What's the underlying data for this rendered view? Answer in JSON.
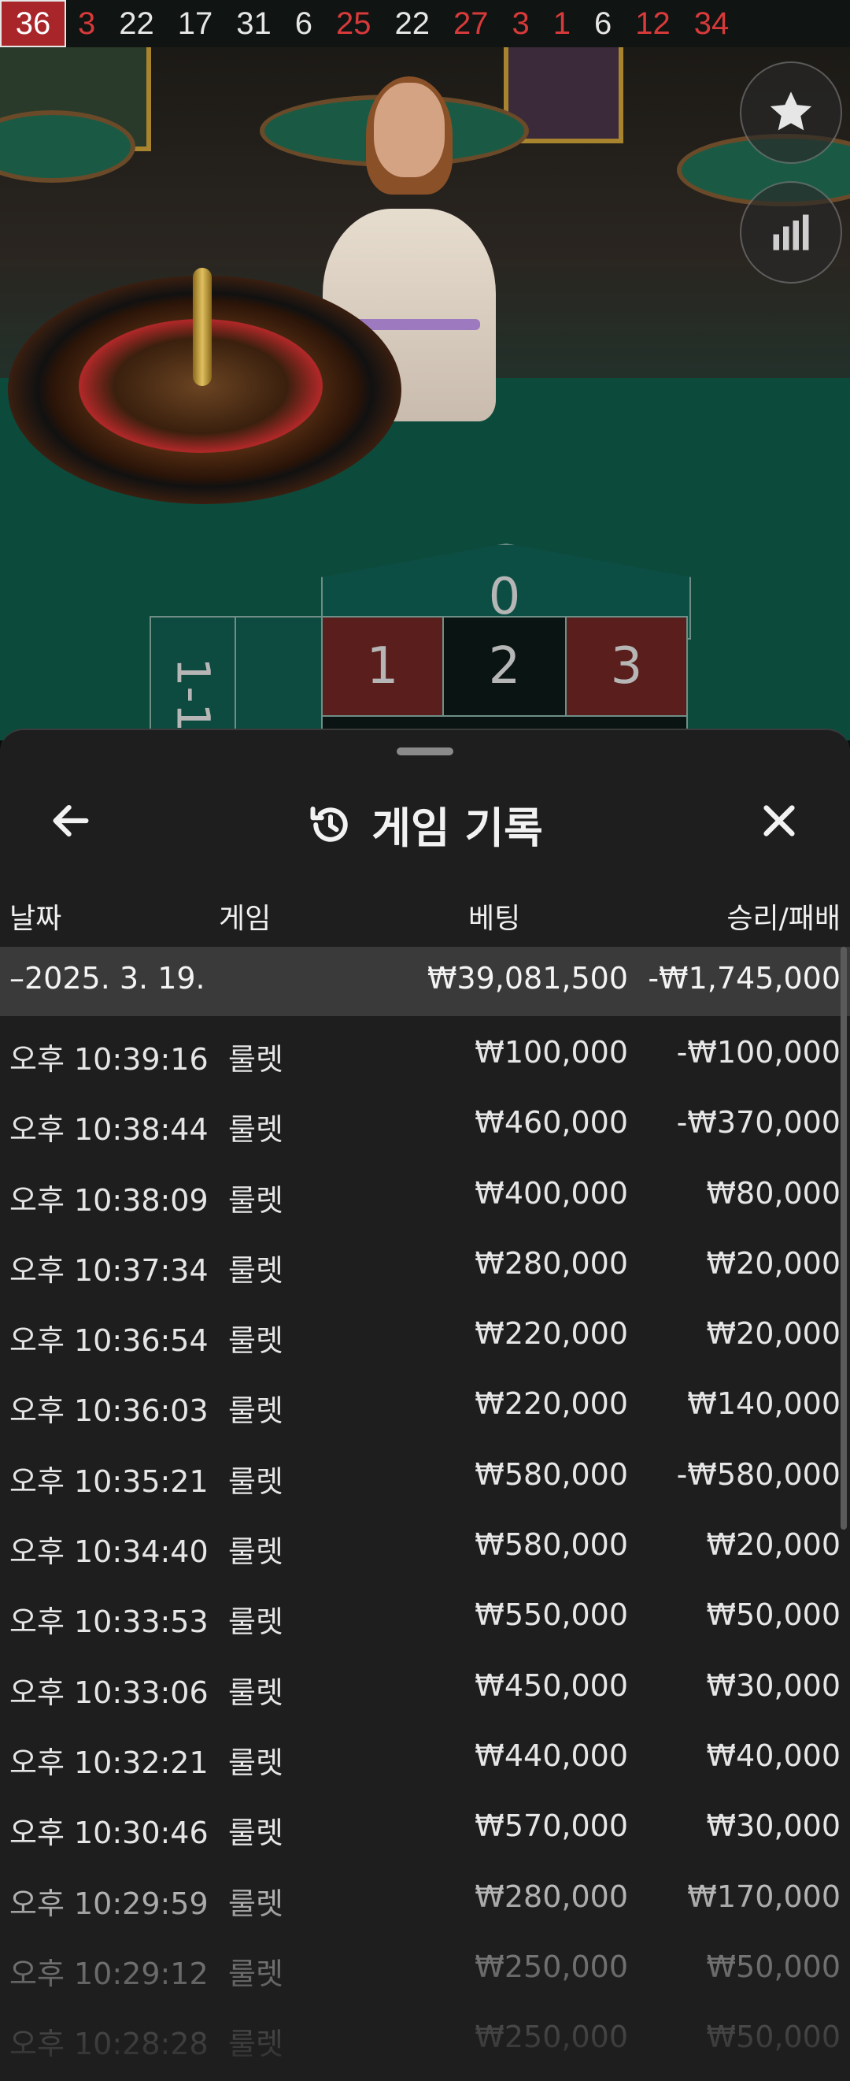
{
  "results_strip": [
    {
      "value": "36",
      "color": "red",
      "latest": true
    },
    {
      "value": "3",
      "color": "red"
    },
    {
      "value": "22",
      "color": "black"
    },
    {
      "value": "17",
      "color": "black"
    },
    {
      "value": "31",
      "color": "black"
    },
    {
      "value": "6",
      "color": "black"
    },
    {
      "value": "25",
      "color": "red"
    },
    {
      "value": "22",
      "color": "black"
    },
    {
      "value": "27",
      "color": "red"
    },
    {
      "value": "3",
      "color": "red"
    },
    {
      "value": "1",
      "color": "red"
    },
    {
      "value": "6",
      "color": "black"
    },
    {
      "value": "12",
      "color": "red"
    },
    {
      "value": "34",
      "color": "red"
    }
  ],
  "board": {
    "zero": "0",
    "row1": [
      "1",
      "2",
      "3"
    ],
    "column_label": "1-1"
  },
  "side_buttons": [
    "star-icon",
    "stats-icon"
  ],
  "sheet": {
    "title": "게임 기록",
    "columns": {
      "date": "날짜",
      "game": "게임",
      "bet": "베팅",
      "result": "승리/패배"
    },
    "summary": {
      "date": "–2025. 3. 19.",
      "bet": "₩39,081,500",
      "result": "-₩1,745,000"
    },
    "rows": [
      {
        "time": "오후 10:39:16",
        "game": "룰렛",
        "bet": "₩100,000",
        "result": "-₩100,000"
      },
      {
        "time": "오후 10:38:44",
        "game": "룰렛",
        "bet": "₩460,000",
        "result": "-₩370,000"
      },
      {
        "time": "오후 10:38:09",
        "game": "룰렛",
        "bet": "₩400,000",
        "result": "₩80,000"
      },
      {
        "time": "오후 10:37:34",
        "game": "룰렛",
        "bet": "₩280,000",
        "result": "₩20,000"
      },
      {
        "time": "오후 10:36:54",
        "game": "룰렛",
        "bet": "₩220,000",
        "result": "₩20,000"
      },
      {
        "time": "오후 10:36:03",
        "game": "룰렛",
        "bet": "₩220,000",
        "result": "₩140,000"
      },
      {
        "time": "오후 10:35:21",
        "game": "룰렛",
        "bet": "₩580,000",
        "result": "-₩580,000"
      },
      {
        "time": "오후 10:34:40",
        "game": "룰렛",
        "bet": "₩580,000",
        "result": "₩20,000"
      },
      {
        "time": "오후 10:33:53",
        "game": "룰렛",
        "bet": "₩550,000",
        "result": "₩50,000"
      },
      {
        "time": "오후 10:33:06",
        "game": "룰렛",
        "bet": "₩450,000",
        "result": "₩30,000"
      },
      {
        "time": "오후 10:32:21",
        "game": "룰렛",
        "bet": "₩440,000",
        "result": "₩40,000"
      },
      {
        "time": "오후 10:30:46",
        "game": "룰렛",
        "bet": "₩570,000",
        "result": "₩30,000"
      },
      {
        "time": "오후 10:29:59",
        "game": "룰렛",
        "bet": "₩280,000",
        "result": "₩170,000"
      },
      {
        "time": "오후 10:29:12",
        "game": "룰렛",
        "bet": "₩250,000",
        "result": "₩50,000"
      },
      {
        "time": "오후 10:28:28",
        "game": "룰렛",
        "bet": "₩250,000",
        "result": "₩50,000"
      }
    ]
  }
}
